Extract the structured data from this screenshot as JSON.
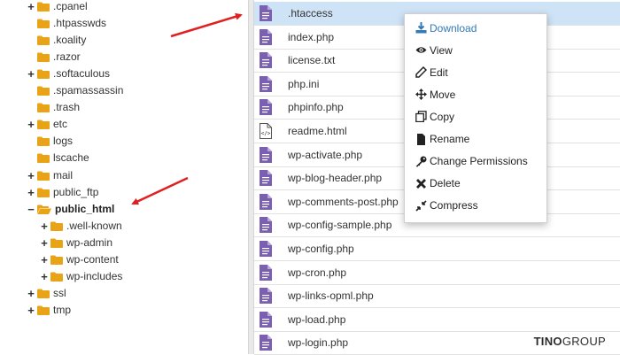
{
  "tree": {
    "items": [
      {
        "label": ".cpanel",
        "expander": "+",
        "bold": false,
        "indent": 0
      },
      {
        "label": ".htpasswds",
        "expander": "",
        "bold": false,
        "indent": 0
      },
      {
        "label": ".koality",
        "expander": "",
        "bold": false,
        "indent": 0
      },
      {
        "label": ".razor",
        "expander": "",
        "bold": false,
        "indent": 0
      },
      {
        "label": ".softaculous",
        "expander": "+",
        "bold": false,
        "indent": 0
      },
      {
        "label": ".spamassassin",
        "expander": "",
        "bold": false,
        "indent": 0
      },
      {
        "label": ".trash",
        "expander": "",
        "bold": false,
        "indent": 0
      },
      {
        "label": "etc",
        "expander": "+",
        "bold": false,
        "indent": 0
      },
      {
        "label": "logs",
        "expander": "",
        "bold": false,
        "indent": 0
      },
      {
        "label": "lscache",
        "expander": "",
        "bold": false,
        "indent": 0
      },
      {
        "label": "mail",
        "expander": "+",
        "bold": false,
        "indent": 0
      },
      {
        "label": "public_ftp",
        "expander": "+",
        "bold": false,
        "indent": 0
      },
      {
        "label": "public_html",
        "expander": "−",
        "bold": true,
        "indent": 0
      },
      {
        "label": ".well-known",
        "expander": "+",
        "bold": false,
        "indent": 1
      },
      {
        "label": "wp-admin",
        "expander": "+",
        "bold": false,
        "indent": 1
      },
      {
        "label": "wp-content",
        "expander": "+",
        "bold": false,
        "indent": 1
      },
      {
        "label": "wp-includes",
        "expander": "+",
        "bold": false,
        "indent": 1
      },
      {
        "label": "ssl",
        "expander": "+",
        "bold": false,
        "indent": 0
      },
      {
        "label": "tmp",
        "expander": "+",
        "bold": false,
        "indent": 0
      }
    ]
  },
  "files": [
    {
      "name": ".htaccess",
      "icon": "file-icon",
      "selected": true
    },
    {
      "name": "index.php",
      "icon": "file-icon",
      "selected": false
    },
    {
      "name": "license.txt",
      "icon": "file-icon",
      "selected": false
    },
    {
      "name": "php.ini",
      "icon": "file-icon",
      "selected": false
    },
    {
      "name": "phpinfo.php",
      "icon": "file-icon",
      "selected": false
    },
    {
      "name": "readme.html",
      "icon": "html-file-icon",
      "selected": false
    },
    {
      "name": "wp-activate.php",
      "icon": "file-icon",
      "selected": false
    },
    {
      "name": "wp-blog-header.php",
      "icon": "file-icon",
      "selected": false
    },
    {
      "name": "wp-comments-post.php",
      "icon": "file-icon",
      "selected": false
    },
    {
      "name": "wp-config-sample.php",
      "icon": "file-icon",
      "selected": false
    },
    {
      "name": "wp-config.php",
      "icon": "file-icon",
      "selected": false
    },
    {
      "name": "wp-cron.php",
      "icon": "file-icon",
      "selected": false
    },
    {
      "name": "wp-links-opml.php",
      "icon": "file-icon",
      "selected": false
    },
    {
      "name": "wp-load.php",
      "icon": "file-icon",
      "selected": false
    },
    {
      "name": "wp-login.php",
      "icon": "file-icon",
      "selected": false
    }
  ],
  "context_menu": {
    "items": [
      {
        "label": "Download",
        "icon": "download-icon"
      },
      {
        "label": "View",
        "icon": "eye-icon"
      },
      {
        "label": "Edit",
        "icon": "pencil-icon"
      },
      {
        "label": "Move",
        "icon": "move-icon"
      },
      {
        "label": "Copy",
        "icon": "copy-icon"
      },
      {
        "label": "Rename",
        "icon": "rename-icon"
      },
      {
        "label": "Change Permissions",
        "icon": "key-icon"
      },
      {
        "label": "Delete",
        "icon": "delete-icon"
      },
      {
        "label": "Compress",
        "icon": "compress-icon"
      }
    ]
  },
  "watermark": {
    "brand": "TINO",
    "suffix": "GROUP"
  },
  "colors": {
    "folder": "#e8a317",
    "file_icon": "#7b5fb0",
    "selected_row": "#cfe3f7",
    "arrow": "#e02020",
    "menu_accent": "#337ab7"
  }
}
